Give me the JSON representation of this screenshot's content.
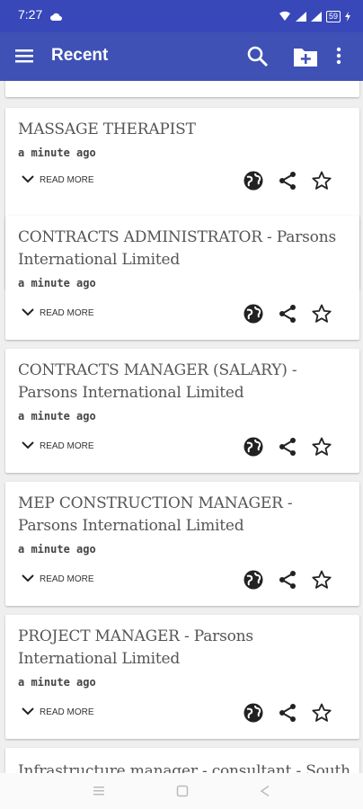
{
  "status": {
    "time": "7:27",
    "battery": "59"
  },
  "appbar": {
    "title": "Recent"
  },
  "cards": [
    {
      "title": "",
      "ago": "",
      "read_more": ""
    },
    {
      "title": "MASSAGE THERAPIST",
      "ago": "a minute ago",
      "read_more": "READ MORE"
    },
    {
      "title": "CONTRACTS ADMINISTRATOR - Parsons International Limited",
      "ago": "a minute ago",
      "read_more": "READ MORE"
    },
    {
      "title": "CONTRACTS MANAGER (SALARY) - Parsons International Limited",
      "ago": "a minute ago",
      "read_more": "READ MORE"
    },
    {
      "title": "MEP CONSTRUCTION MANAGER - Parsons International Limited",
      "ago": "a minute ago",
      "read_more": "READ MORE"
    },
    {
      "title": "PROJECT MANAGER - Parsons International Limited",
      "ago": "a minute ago",
      "read_more": "READ MORE"
    },
    {
      "title": "Infrastructure manager - consultant - Southie",
      "ago": "",
      "read_more": ""
    }
  ],
  "icons": {
    "menu": "menu-icon",
    "search": "search-icon",
    "folder": "create-new-folder-icon",
    "more": "more-vertical-icon",
    "globe": "globe-icon",
    "share": "share-icon",
    "star": "star-outline-icon",
    "expand": "chevron-down-icon"
  },
  "colors": {
    "primary": "#3f51b5",
    "status_bar": "#3848b9",
    "background": "#efefef"
  }
}
